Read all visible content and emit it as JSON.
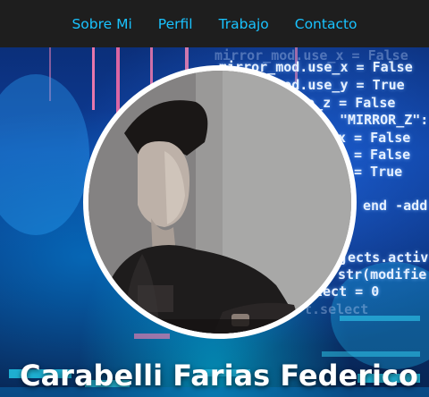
{
  "nav": {
    "items": [
      {
        "label": "Sobre Mi"
      },
      {
        "label": "Perfil"
      },
      {
        "label": "Trabajo"
      },
      {
        "label": "Contacto"
      }
    ]
  },
  "background_code": {
    "lines": [
      "mirror_mod.use_x = False",
      "mirror_mod.use_y = True",
      "use_z = False",
      "\"MIRROR_Z\":",
      "x = False",
      "= False",
      "= True",
      "end -add",
      "jects.activ",
      "str(modifie",
      "lect = 0",
      "t.select"
    ]
  },
  "profile": {
    "name": "Carabelli Farias Federico"
  },
  "colors": {
    "navbar_bg": "#1e1e1e",
    "nav_link": "#19c3ff",
    "avatar_border": "#ffffff",
    "name_text": "#ffffff"
  },
  "icons": {
    "avatar": "profile-photo"
  }
}
